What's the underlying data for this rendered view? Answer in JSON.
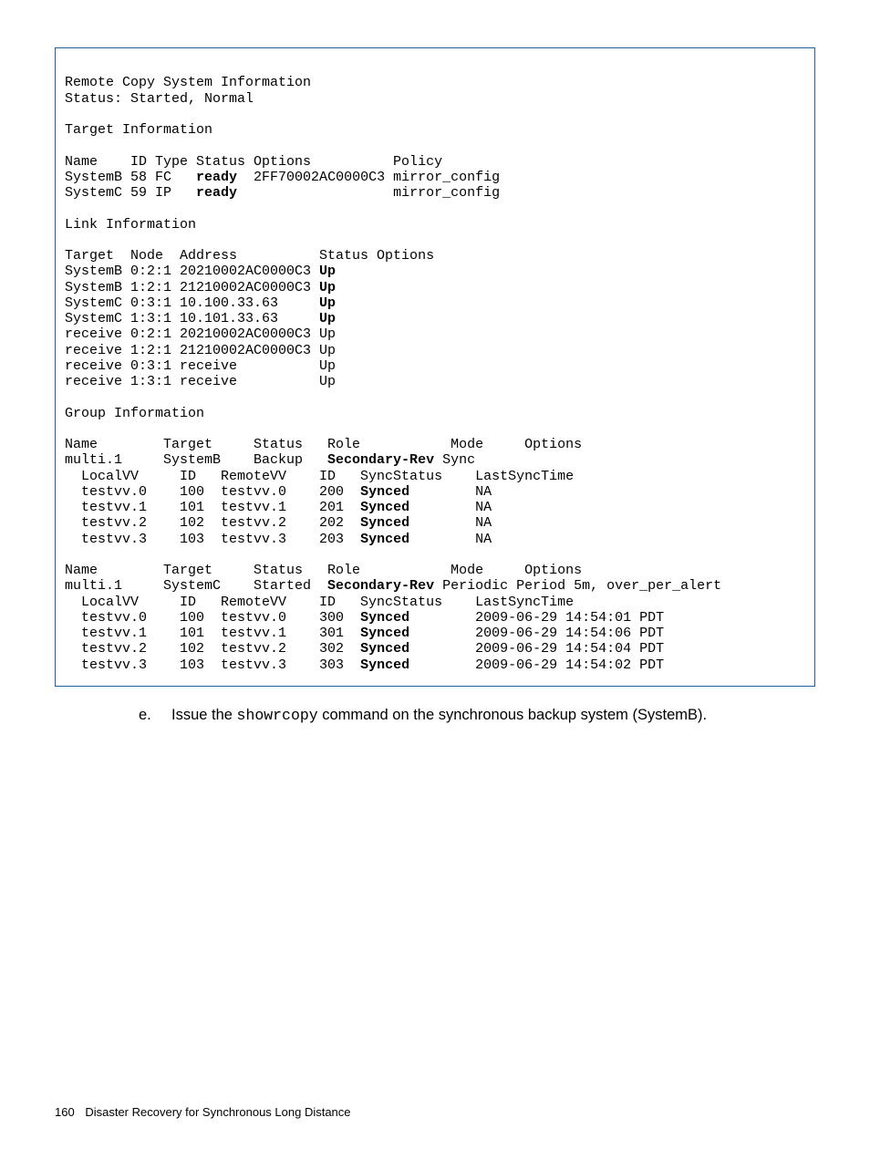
{
  "code": {
    "blank": "",
    "l1": "Remote Copy System Information",
    "l2": "Status: Started, Normal",
    "l3": "Target Information",
    "l4": "Name    ID Type Status Options          Policy",
    "l5a": "SystemB 58 FC   ",
    "l5b": "ready",
    "l5c": "  2FF70002AC0000C3 mirror_config",
    "l6a": "SystemC 59 IP   ",
    "l6b": "ready",
    "l6c": "                   mirror_config",
    "l7": "Link Information",
    "l8": "Target  Node  Address          Status Options",
    "l9a": "SystemB 0:2:1 20210002AC0000C3 ",
    "l9b": "Up",
    "l10a": "SystemB 1:2:1 21210002AC0000C3 ",
    "l10b": "Up",
    "l11a": "SystemC 0:3:1 10.100.33.63     ",
    "l11b": "Up",
    "l12a": "SystemC 1:3:1 10.101.33.63     ",
    "l12b": "Up",
    "l13": "receive 0:2:1 20210002AC0000C3 Up",
    "l14": "receive 1:2:1 21210002AC0000C3 Up",
    "l15": "receive 0:3:1 receive          Up",
    "l16": "receive 1:3:1 receive          Up",
    "l17": "Group Information",
    "l18": "Name        Target     Status   Role           Mode     Options",
    "l19a": "multi.1     SystemB    Backup   ",
    "l19b": "Secondary-Rev",
    "l19c": " Sync",
    "l20": "  LocalVV     ID   RemoteVV    ID   SyncStatus    LastSyncTime",
    "l21a": "  testvv.0    100  testvv.0    200  ",
    "l21b": "Synced",
    "l21c": "        NA",
    "l22a": "  testvv.1    101  testvv.1    201  ",
    "l22b": "Synced",
    "l22c": "        NA",
    "l23a": "  testvv.2    102  testvv.2    202  ",
    "l23b": "Synced",
    "l23c": "        NA",
    "l24a": "  testvv.3    103  testvv.3    203  ",
    "l24b": "Synced",
    "l24c": "        NA",
    "l25": "Name        Target     Status   Role           Mode     Options",
    "l26a": "multi.1     SystemC    Started  ",
    "l26b": "Secondary-Rev",
    "l26c": " Periodic Period 5m, over_per_alert",
    "l27": "  LocalVV     ID   RemoteVV    ID   SyncStatus    LastSyncTime",
    "l28a": "  testvv.0    100  testvv.0    300  ",
    "l28b": "Synced",
    "l28c": "        2009-06-29 14:54:01 PDT",
    "l29a": "  testvv.1    101  testvv.1    301  ",
    "l29b": "Synced",
    "l29c": "        2009-06-29 14:54:06 PDT",
    "l30a": "  testvv.2    102  testvv.2    302  ",
    "l30b": "Synced",
    "l30c": "        2009-06-29 14:54:04 PDT",
    "l31a": "  testvv.3    103  testvv.3    303  ",
    "l31b": "Synced",
    "l31c": "        2009-06-29 14:54:02 PDT"
  },
  "step": {
    "marker": "e.",
    "t1": "Issue the ",
    "cmd": "showrcopy",
    "t2": " command on the synchronous backup system (SystemB)."
  },
  "footer": {
    "page": "160",
    "title": "Disaster Recovery for Synchronous Long Distance"
  }
}
